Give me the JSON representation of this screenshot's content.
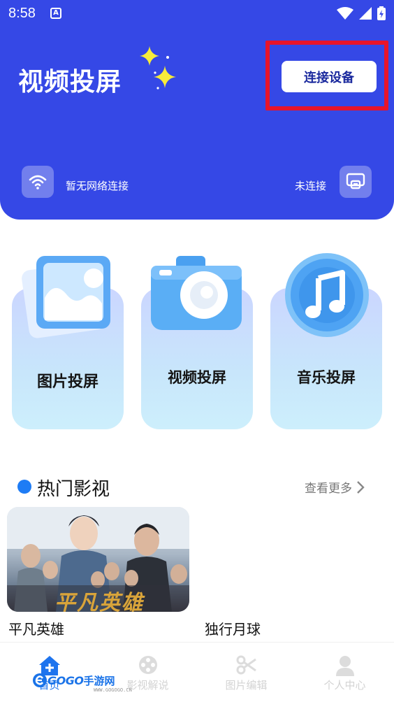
{
  "status_bar": {
    "time": "8:58",
    "notification_badge": "A"
  },
  "header": {
    "title": "视频投屏",
    "connect_button": "连接设备",
    "network_status": "暂无网络连接",
    "connection_status": "未连接",
    "highlight_color": "#e8142a",
    "background_color": "#3548e6"
  },
  "features": [
    {
      "label": "图片投屏",
      "icon": "picture-icon"
    },
    {
      "label": "视频投屏",
      "icon": "camera-icon"
    },
    {
      "label": "音乐投屏",
      "icon": "music-icon"
    }
  ],
  "hot_section": {
    "title": "热门影视",
    "more_label": "查看更多",
    "items": [
      {
        "title": "平凡英雄",
        "poster_text": "平凡英雄"
      },
      {
        "title": "独行月球"
      }
    ]
  },
  "tabbar": {
    "tabs": [
      {
        "label": "首页",
        "icon": "home-plus-icon",
        "active": true
      },
      {
        "label": "影视解说",
        "icon": "film-reel-icon"
      },
      {
        "label": "图片编辑",
        "icon": "scissors-icon"
      },
      {
        "label": "个人中心",
        "icon": "person-icon"
      }
    ]
  },
  "watermark": {
    "text": "GOGO",
    "text2": "手游网",
    "sub": "WWW.GOGOGO.CN"
  }
}
